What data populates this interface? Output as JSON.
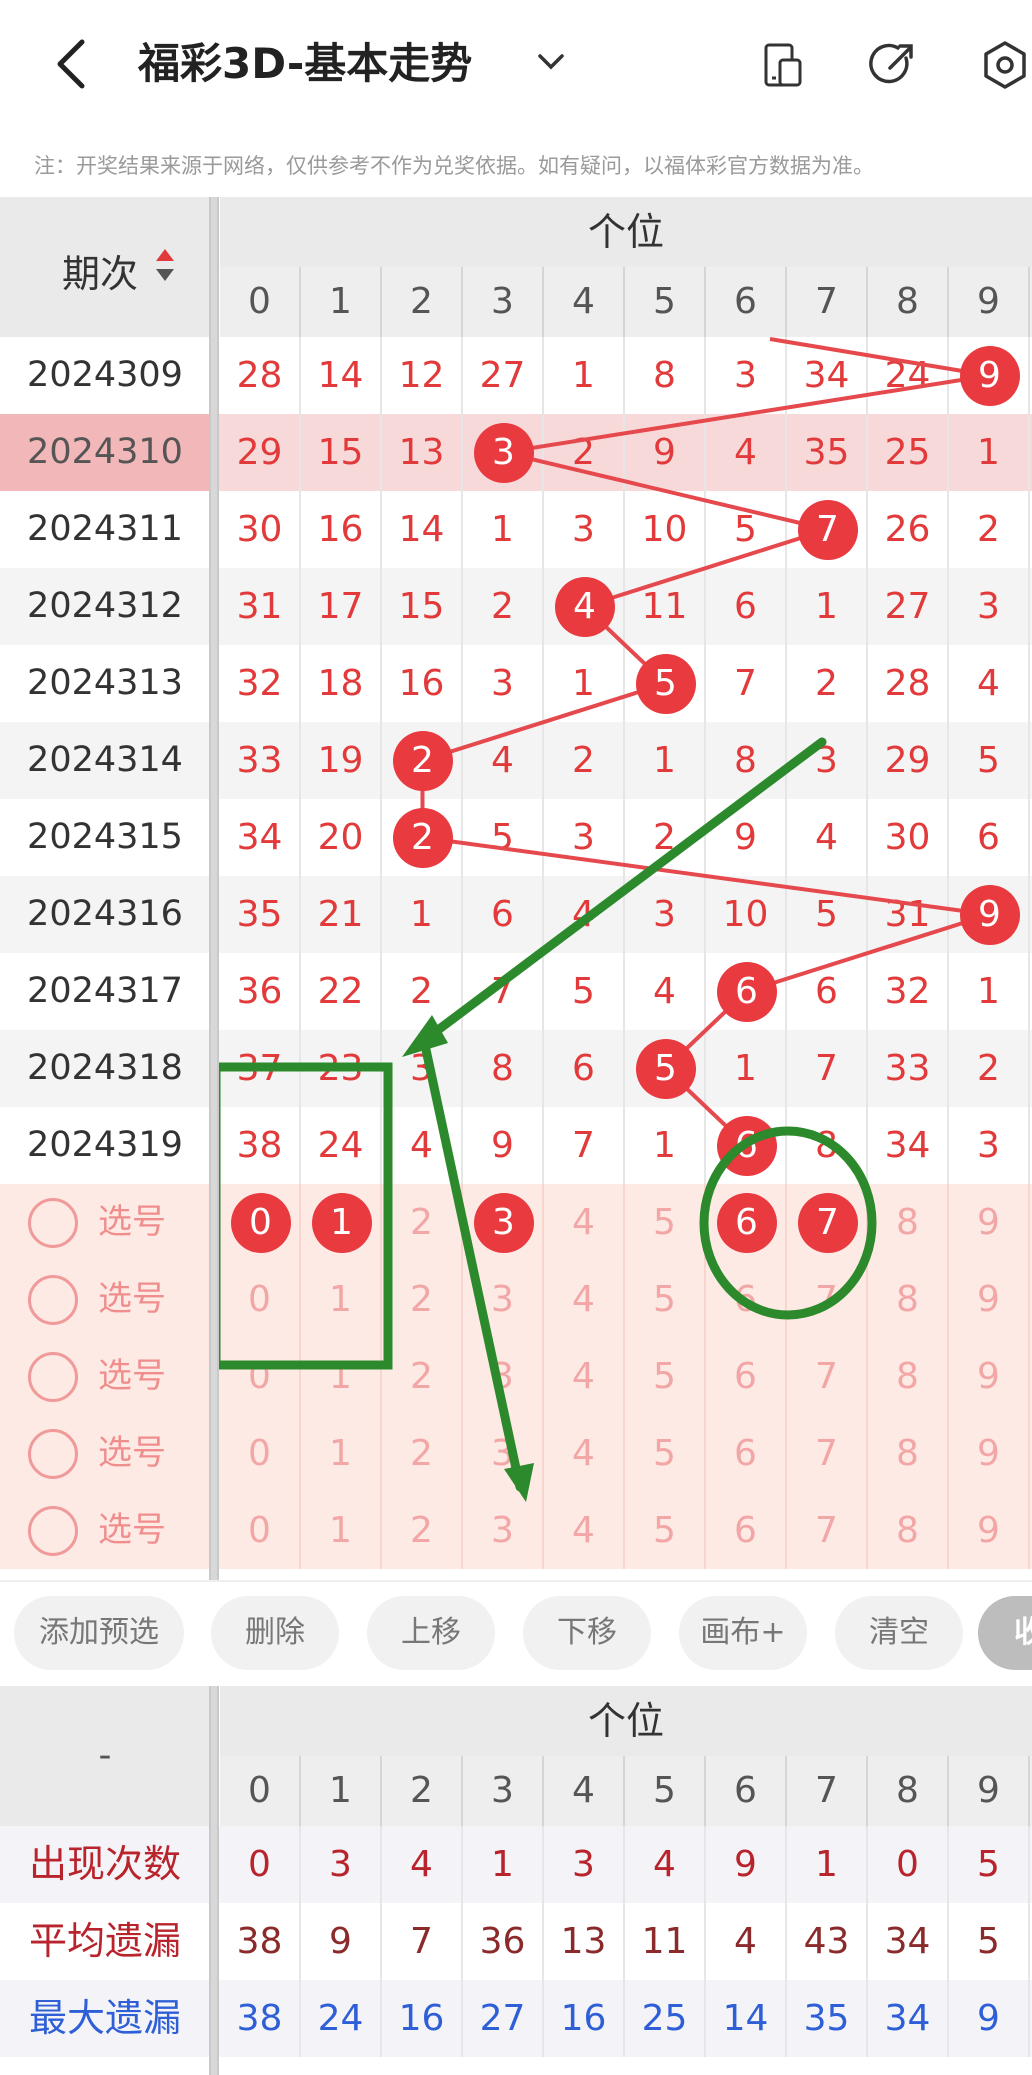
{
  "header": {
    "title": "福彩3D-基本走势",
    "note": "注：开奖结果来源于网络，仅供参考不作为兑奖依据。如有疑问，以福体彩官方数据为准。"
  },
  "table": {
    "period_header": "期次",
    "group_header": "个位",
    "digits": [
      "0",
      "1",
      "2",
      "3",
      "4",
      "5",
      "6",
      "7",
      "8",
      "9"
    ],
    "rows": [
      {
        "period": "2024309",
        "cells": [
          "28",
          "14",
          "12",
          "27",
          "1",
          "8",
          "3",
          "34",
          "24",
          ""
        ],
        "hit": 9
      },
      {
        "period": "2024310",
        "cells": [
          "29",
          "15",
          "13",
          "",
          "2",
          "9",
          "4",
          "35",
          "25",
          "1"
        ],
        "hit": 3
      },
      {
        "period": "2024311",
        "cells": [
          "30",
          "16",
          "14",
          "1",
          "3",
          "10",
          "5",
          "",
          "26",
          "2"
        ],
        "hit": 7
      },
      {
        "period": "2024312",
        "cells": [
          "31",
          "17",
          "15",
          "2",
          "",
          "11",
          "6",
          "1",
          "27",
          "3"
        ],
        "hit": 4
      },
      {
        "period": "2024313",
        "cells": [
          "32",
          "18",
          "16",
          "3",
          "1",
          "",
          "7",
          "2",
          "28",
          "4"
        ],
        "hit": 5
      },
      {
        "period": "2024314",
        "cells": [
          "33",
          "19",
          "",
          "4",
          "2",
          "1",
          "8",
          "3",
          "29",
          "5"
        ],
        "hit": 2
      },
      {
        "period": "2024315",
        "cells": [
          "34",
          "20",
          "",
          "5",
          "3",
          "2",
          "9",
          "4",
          "30",
          "6"
        ],
        "hit": 2
      },
      {
        "period": "2024316",
        "cells": [
          "35",
          "21",
          "1",
          "6",
          "4",
          "3",
          "10",
          "5",
          "31",
          ""
        ],
        "hit": 9
      },
      {
        "period": "2024317",
        "cells": [
          "36",
          "22",
          "2",
          "7",
          "5",
          "4",
          "",
          "6",
          "32",
          "1"
        ],
        "hit": 6
      },
      {
        "period": "2024318",
        "cells": [
          "37",
          "23",
          "3",
          "8",
          "6",
          "",
          "1",
          "7",
          "33",
          "2"
        ],
        "hit": 5
      },
      {
        "period": "2024319",
        "cells": [
          "38",
          "24",
          "4",
          "9",
          "7",
          "1",
          "",
          "8",
          "34",
          "3"
        ],
        "hit": 6
      }
    ],
    "select_label": "选号",
    "select_rows": 5,
    "selected_first_row": [
      "0",
      "1",
      "3",
      "6",
      "7"
    ]
  },
  "toolbar": {
    "buttons": [
      "添加预选",
      "删除",
      "上移",
      "下移",
      "画布+",
      "清空",
      "收起"
    ]
  },
  "stats": {
    "left_header": "-",
    "group_header": "个位",
    "rows": [
      {
        "label": "出现次数",
        "color": "#b8232c",
        "value_color": "#b8232c",
        "values": [
          "0",
          "3",
          "4",
          "1",
          "3",
          "4",
          "9",
          "1",
          "0",
          "5"
        ]
      },
      {
        "label": "平均遗漏",
        "color": "#b8232c",
        "value_color": "#8b2a2a",
        "values": [
          "38",
          "9",
          "7",
          "36",
          "13",
          "11",
          "4",
          "43",
          "34",
          "5"
        ]
      },
      {
        "label": "最大遗漏",
        "color": "#2f5fd6",
        "value_color": "#2f5fd6",
        "values": [
          "38",
          "24",
          "16",
          "27",
          "16",
          "25",
          "14",
          "35",
          "34",
          "9"
        ]
      }
    ]
  },
  "colors": {
    "ball": "#e83a3f",
    "annotation_green": "#2c8a2c"
  }
}
